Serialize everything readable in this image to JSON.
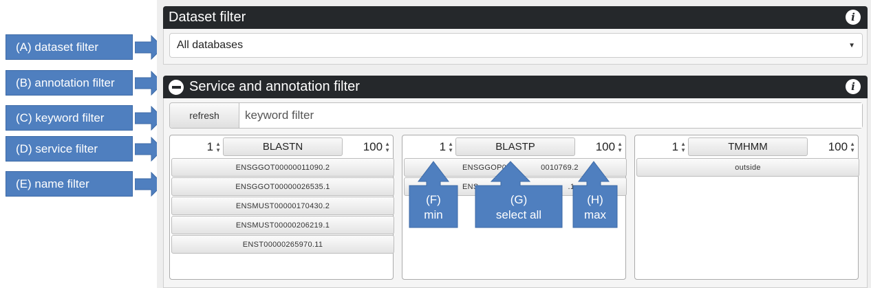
{
  "callouts": [
    {
      "label": "(A) dataset filter"
    },
    {
      "label": "(B) annotation filter"
    },
    {
      "label": "(C) keyword filter"
    },
    {
      "label": "(D) service filter"
    },
    {
      "label": "(E) name filter"
    }
  ],
  "dataset_panel": {
    "title": "Dataset filter",
    "info_icon": "i",
    "selected": "All databases"
  },
  "annotation_panel": {
    "title": "Service and annotation filter",
    "info_icon": "i",
    "refresh_label": "refresh",
    "keyword_placeholder": "keyword filter"
  },
  "services": [
    {
      "min": "1",
      "name": "BLASTN",
      "max": "100",
      "items": [
        "ENSGGOT00000011090.2",
        "ENSGGOT00000026535.1",
        "ENSMUST00000170430.2",
        "ENSMUST00000206219.1",
        "ENST00000265970.11"
      ]
    },
    {
      "min": "1",
      "name": "BLASTP",
      "max": "100",
      "items": [
        "ENSGGOP0",
        "0010769.2",
        "ENS",
        ".1"
      ]
    },
    {
      "min": "1",
      "name": "TMHMM",
      "max": "100",
      "items": [
        "outside"
      ]
    }
  ],
  "bottom_callouts": [
    {
      "line1": "(F)",
      "line2": "min"
    },
    {
      "line1": "(G)",
      "line2": "select all"
    },
    {
      "line1": "(H)",
      "line2": "max"
    }
  ],
  "colors": {
    "callout": "#4f7fbf",
    "panel_header": "#25282b"
  }
}
